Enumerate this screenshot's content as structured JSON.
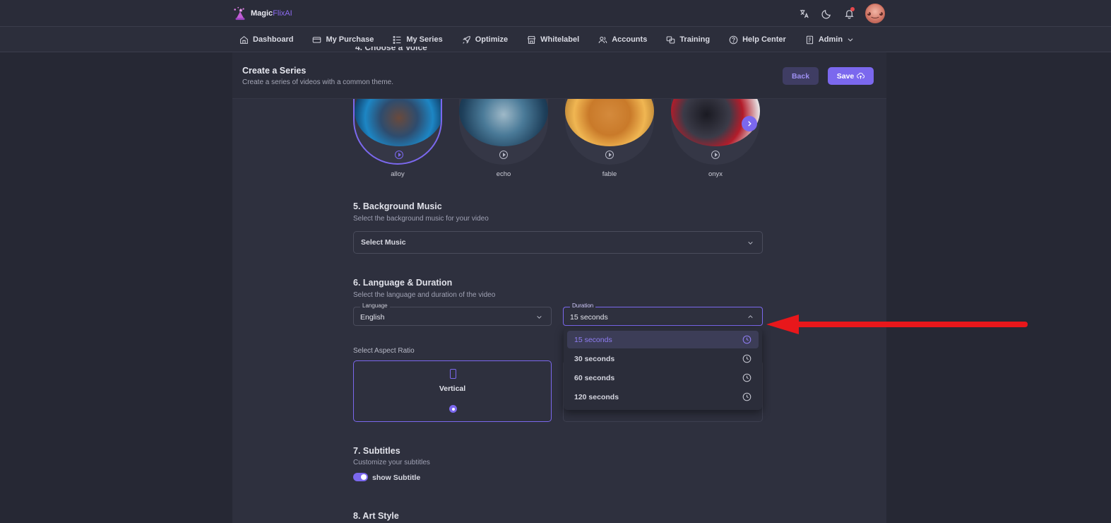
{
  "brand": {
    "name_main": "Magic",
    "name_accent": "FlixAI"
  },
  "topbar": {
    "icons": [
      "translate-icon",
      "moon-icon",
      "bell-icon"
    ],
    "avatar_label": "◕‿◕"
  },
  "nav": {
    "items": [
      {
        "label": "Dashboard",
        "icon": "home-icon"
      },
      {
        "label": "My Purchase",
        "icon": "card-icon"
      },
      {
        "label": "My Series",
        "icon": "list-icon"
      },
      {
        "label": "Optimize",
        "icon": "rocket-icon"
      },
      {
        "label": "Whitelabel",
        "icon": "store-icon"
      },
      {
        "label": "Accounts",
        "icon": "users-icon"
      },
      {
        "label": "Training",
        "icon": "training-icon"
      },
      {
        "label": "Help Center",
        "icon": "help-icon"
      },
      {
        "label": "Admin",
        "icon": "admin-icon"
      }
    ]
  },
  "header": {
    "title": "Create a Series",
    "subtitle": "Create a series of videos with a common theme.",
    "back_label": "Back",
    "save_label": "Save",
    "partial_section": "4. Choose a Voice"
  },
  "voices": {
    "items": [
      {
        "name": "alloy",
        "selected": true
      },
      {
        "name": "echo",
        "selected": false
      },
      {
        "name": "fable",
        "selected": false
      },
      {
        "name": "onyx",
        "selected": false
      }
    ]
  },
  "music": {
    "title": "5. Background Music",
    "desc": "Select the background music for your video",
    "select_label": "Select Music"
  },
  "language_duration": {
    "title": "6. Language & Duration",
    "desc": "Select the language and duration of the video",
    "language_label": "Language",
    "language_value": "English",
    "duration_label": "Duration",
    "duration_value": "15 seconds",
    "duration_options": [
      "15 seconds",
      "30 seconds",
      "60 seconds",
      "120 seconds"
    ]
  },
  "aspect": {
    "label": "Select Aspect Ratio",
    "option": "Vertical"
  },
  "subtitles": {
    "title": "7. Subtitles",
    "desc": "Customize your subtitles",
    "toggle_label": "show Subtitle",
    "enabled": true
  },
  "art_style": {
    "title": "8. Art Style"
  },
  "colors": {
    "accent": "#7b68ee",
    "annotation": "#e8171b"
  }
}
